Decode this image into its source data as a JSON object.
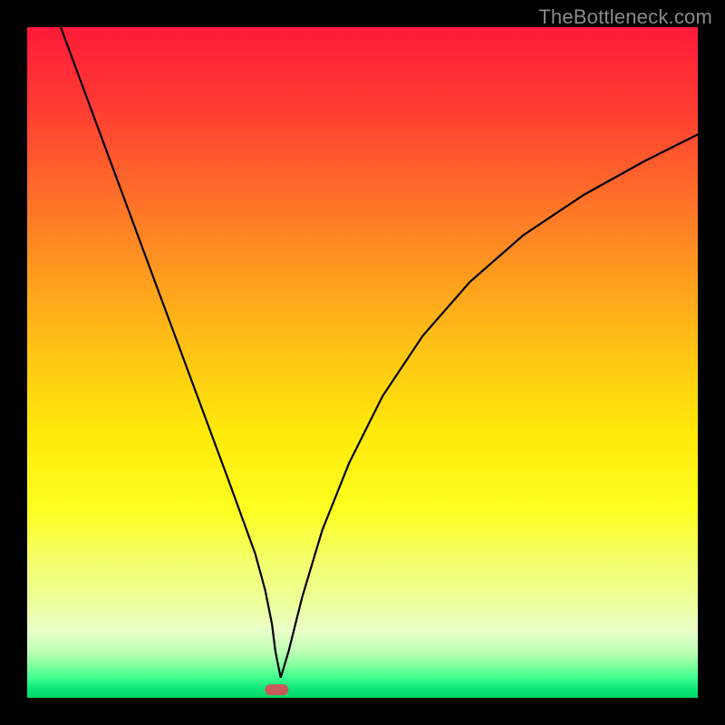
{
  "watermark": "TheBottleneck.com",
  "chart_data": {
    "type": "line",
    "title": "",
    "xlabel": "",
    "ylabel": "",
    "xlim": [
      0,
      100
    ],
    "ylim": [
      0,
      100
    ],
    "background_gradient": {
      "top": "#ff1a3a",
      "middle": "#ffe80a",
      "bottom": "#00d868"
    },
    "series": [
      {
        "name": "bottleneck-curve",
        "x": [
          5,
          10,
          15,
          20,
          25,
          30,
          32,
          34,
          35.5,
          36.5,
          37,
          37.8,
          39,
          41,
          44,
          48,
          53,
          59,
          66,
          74,
          83,
          92,
          100
        ],
        "values": [
          100,
          86.5,
          73,
          59.5,
          46,
          32.5,
          27,
          21.5,
          16,
          11,
          7,
          3,
          7,
          15,
          25,
          35,
          45,
          54,
          62,
          69,
          75,
          80,
          84
        ]
      }
    ],
    "marker": {
      "x": 37.2,
      "y": 1.2,
      "name": "optimal-point",
      "color": "#c95a5a"
    }
  }
}
